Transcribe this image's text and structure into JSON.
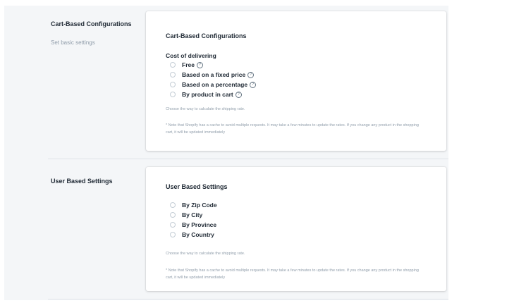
{
  "cart_section": {
    "annotation_title": "Cart-Based Configurations",
    "annotation_description": "Set basic settings",
    "card_title": "Cart-Based Configurations",
    "field_label": "Cost of delivering",
    "options": [
      {
        "label": "Free",
        "help": "?"
      },
      {
        "label": "Based on a fixed price",
        "help": "?"
      },
      {
        "label": "Based on a percentage",
        "help": "?"
      },
      {
        "label": "By product in cart",
        "help": "?"
      }
    ],
    "help_text": "Choose the way to calculate the shipping rate.",
    "note": "* Note that Shopify has a cache to avoid multiple requests. It may take a few minutes to update the rates. If you change any product in the shopping cart, it will be updated immediately"
  },
  "user_section": {
    "annotation_title": "User Based Settings",
    "card_title": "User Based Settings",
    "options": [
      {
        "label": "By Zip Code"
      },
      {
        "label": "By City"
      },
      {
        "label": "By Province"
      },
      {
        "label": "By Country"
      }
    ],
    "help_text": "Choose the way to calculate the shipping rate.",
    "note": "* Note that Shopify has a cache to avoid multiple requests. It may take a few minutes to update the rates. If you change any product in the shopping cart, it will be updated immediately"
  },
  "colors": {
    "page_background": "#f4f6f8",
    "card_background": "#ffffff",
    "text_primary": "#212b36",
    "text_subdued": "#919eab",
    "radio_border": "#c4cdd5"
  }
}
